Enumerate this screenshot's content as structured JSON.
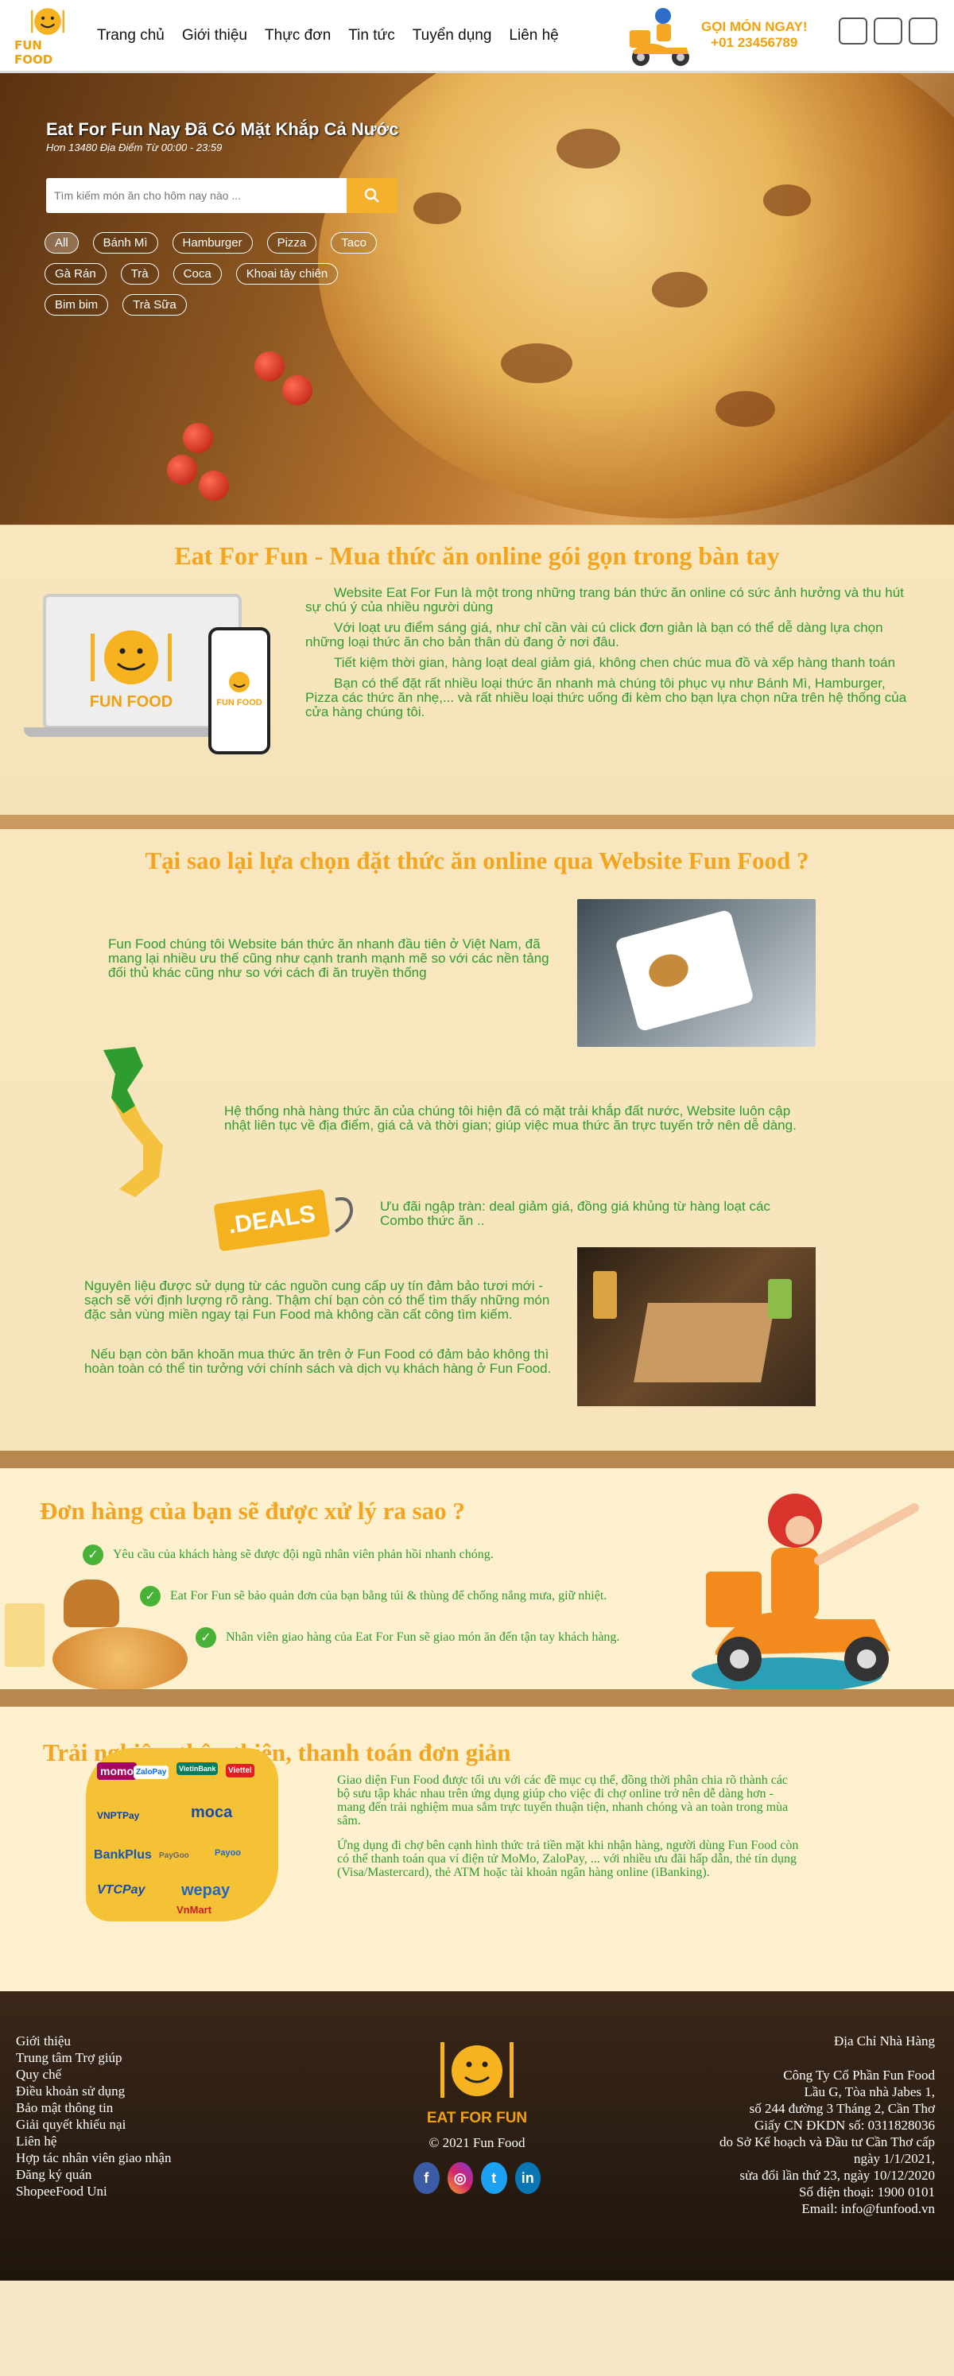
{
  "header": {
    "logo_text": "FUN FOOD",
    "nav": [
      "Trang chủ",
      "Giới thiệu",
      "Thực đơn",
      "Tin tức",
      "Tuyển dụng",
      "Liên hệ"
    ],
    "call_label": "GỌI MÓN NGAY!",
    "call_phone": "+01 23456789"
  },
  "hero": {
    "title": "Eat For Fun Nay Đã Có Mặt Khắp Cả Nước",
    "subtitle": "Hơn 13480 Địa Điểm Từ 00:00 - 23:59",
    "search_placeholder": "Tìm kiếm món ăn cho hôm nay nào ...",
    "tags_row1": [
      "All",
      "Bánh Mì",
      "Hamburger",
      "Pizza",
      "Taco"
    ],
    "tags_row2": [
      "Gà Rán",
      "Trà",
      "Coca",
      "Khoai tây chiên"
    ],
    "tags_row3": [
      "Bim bim",
      "Trà Sữa"
    ]
  },
  "intro": {
    "title": "Eat For Fun - Mua thức ăn online gói gọn trong bàn tay",
    "logo_text": "FUN FOOD",
    "phone_logo_text": "FUN FOOD",
    "paragraphs": [
      "Website Eat For Fun là một trong những trang bán thức ăn online có sức ảnh hưởng và thu hút sự chú ý của nhiều người dùng",
      "Với loạt ưu điểm sáng giá, như chỉ cần vài cú click đơn giản là bạn có thể dễ dàng lựa chọn những loại thức ăn cho bản thân dù đang ở nơi đâu.",
      "Tiết kiệm thời gian, hàng loạt deal giảm giá, không chen chúc mua đồ và xếp hàng thanh toán",
      "Bạn có thể đặt rất nhiều loại thức ăn nhanh mà chúng tôi phục vụ như Bánh Mì, Hamburger, Pizza các thức ăn nhẹ,... và rất nhiều loại thức uống đi kèm cho bạn lựa chọn nữa trên hệ thống của cửa hàng chúng tôi."
    ]
  },
  "why": {
    "title": "Tại sao lại lựa chọn đặt thức ăn online qua Website Fun Food ?",
    "p1": "Fun Food chúng tôi Website bán thức ăn nhanh đầu tiên ở Việt Nam, đã mang lại nhiều ưu thế cũng như cạnh tranh mạnh mẽ so với các nền tảng đối thủ khác cũng như so với cách đi ăn truyền thống",
    "p2": "Hệ thống nhà hàng thức ăn của chúng tôi hiện đã có mặt trải khắp đất nước, Website luôn cập nhật liên tục về địa điểm, giá cả và thời gian; giúp việc mua thức ăn trực tuyến trở nên dễ dàng.",
    "deals_label": ".DEALS",
    "p3": "Ưu đãi ngập tràn: deal giảm giá, đồng giá khủng từ hàng loạt các Combo thức ăn ..",
    "p4": "Nguyên liệu được sử dụng từ các nguồn cung cấp uy tín đảm bảo tươi mới - sạch sẽ với định lượng rõ ràng. Thậm chí bạn còn có thể tìm thấy những món đặc sản vùng miền ngay tại Fun Food mà không cần cất công tìm kiếm.",
    "p5": "Nếu bạn còn băn khoăn mua thức ăn trên ở Fun Food có đảm bảo không thì hoàn toàn có thể tin tưởng với chính sách và dịch vụ khách hàng ở Fun Food."
  },
  "process": {
    "title": "Đơn hàng của bạn sẽ được xử lý ra sao ?",
    "steps": [
      "Yêu cầu của khách hàng sẽ được đội ngũ nhân viên phản hồi nhanh chóng.",
      "Eat For Fun sẽ bảo quản đơn của bạn bằng túi & thùng để chống nắng mưa, giữ nhiệt.",
      "Nhân viên giao hàng của Eat For Fun sẽ giao món ăn đến tận tay khách hàng."
    ]
  },
  "payment": {
    "title": "Trải nghiệm thân thiện, thanh toán đơn giản",
    "logos": [
      "momo",
      "ZaloPay",
      "VietinBank",
      "VNPTPay",
      "moca",
      "BankPlus",
      "PayGoo",
      "Payoo",
      "VTCPay",
      "wepay",
      "VnMart",
      "Viettel"
    ],
    "p1": "Giao diện Fun Food được tối ưu với các đề mục cụ thể, đồng thời phân chia rõ thành các bộ sưu tập khác nhau trên ứng dụng giúp cho việc đi chợ online trở nên dễ dàng hơn - mang đến trải nghiệm mua sắm trực tuyến thuận tiện, nhanh chóng và an toàn trong mùa sâm.",
    "p2": "Ứng dụng đi chợ bên cạnh hình thức trả tiền mặt khi nhận hàng, người dùng Fun Food còn có thể thanh toán qua ví điện tử MoMo, ZaloPay, ... với nhiều ưu đãi hấp dẫn, thẻ tín dụng (Visa/Mastercard), thẻ ATM hoặc tài khoản ngân hàng online (iBanking)."
  },
  "footer": {
    "links": [
      "Giới thiệu",
      "Trung tâm Trợ giúp",
      "Quy chế",
      "Điều khoản sử dụng",
      "Bảo mật thông tin",
      "Giải quyết khiếu nại",
      "Liên hệ",
      "Hợp tác nhân viên giao nhận",
      "Đăng ký quán",
      "ShopeeFood Uni"
    ],
    "brand": "EAT FOR FUN",
    "copyright": "© 2021 Fun Food",
    "address_title": "Địa Chỉ Nhà Hàng",
    "address_lines": [
      "Công Ty Cổ Phần Fun Food",
      "Lầu G, Tòa nhà Jabes 1,",
      "số 244 đường 3 Tháng 2, Cần Thơ",
      "Giấy CN ĐKDN số: 0311828036",
      "do Sở Kế hoạch và Đầu tư Cần Thơ cấp",
      "ngày 1/1/2021,",
      "sửa đổi lần thứ 23, ngày 10/12/2020",
      "Số điện thoại: 1900 0101",
      "Email: info@funfood.vn"
    ],
    "social": [
      "f",
      "ig",
      "t",
      "in"
    ]
  }
}
